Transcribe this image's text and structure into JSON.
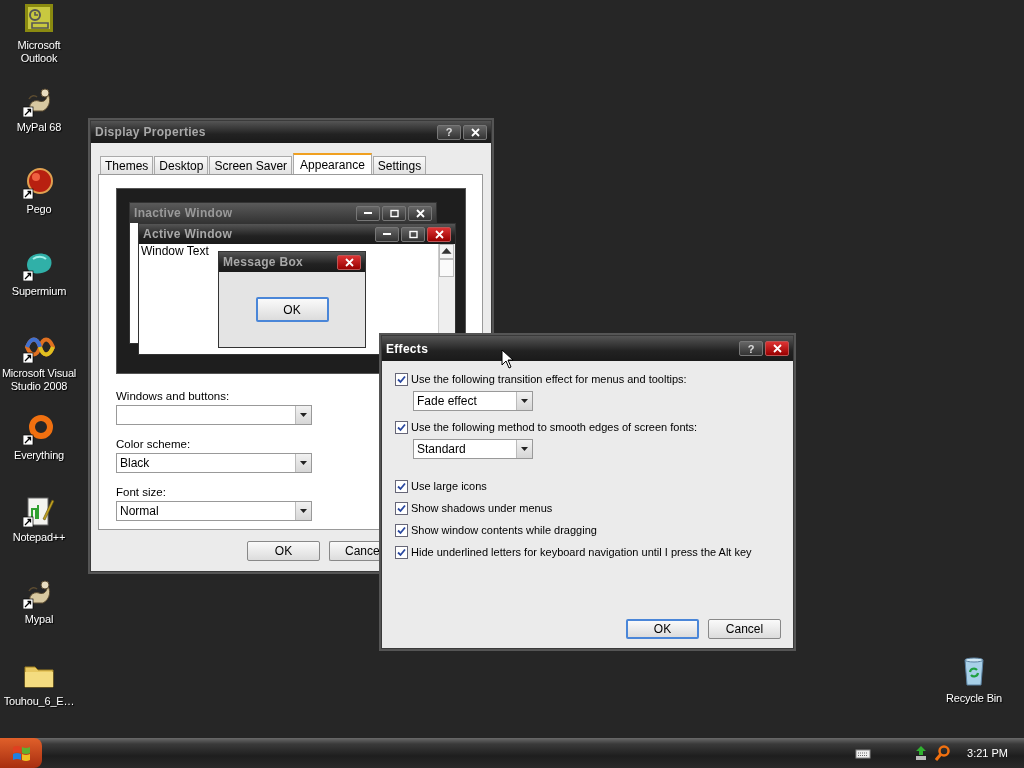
{
  "desktop": {
    "icons": [
      {
        "label": "Microsoft Outlook",
        "kind": "outlook",
        "shortcut": false
      },
      {
        "label": "MyPal 68",
        "kind": "mypal",
        "shortcut": true
      },
      {
        "label": "Pego",
        "kind": "pego",
        "shortcut": true
      },
      {
        "label": "Supermium",
        "kind": "supermium",
        "shortcut": true
      },
      {
        "label": "Microsoft Visual Studio 2008",
        "kind": "visualstudio",
        "shortcut": true
      },
      {
        "label": "Everything",
        "kind": "everything",
        "shortcut": true
      },
      {
        "label": "Notepad++",
        "kind": "notepad",
        "shortcut": true
      },
      {
        "label": "Mypal",
        "kind": "mypal",
        "shortcut": true
      },
      {
        "label": "Touhou_6_E…",
        "kind": "folder",
        "shortcut": false
      }
    ],
    "recycle_bin": {
      "label": "Recycle Bin"
    }
  },
  "display_properties": {
    "title": "Display Properties",
    "help": "?",
    "tabs": [
      {
        "label": "Themes",
        "selected": false
      },
      {
        "label": "Desktop",
        "selected": false
      },
      {
        "label": "Screen Saver",
        "selected": false
      },
      {
        "label": "Appearance",
        "selected": true
      },
      {
        "label": "Settings",
        "selected": false
      }
    ],
    "preview": {
      "inactive_title": "Inactive Window",
      "active_title": "Active Window",
      "window_text": "Window Text",
      "message_title": "Message Box",
      "message_button": {
        "label": "OK",
        "default": true
      }
    },
    "fields": [
      {
        "label": "Windows and buttons:"
      },
      {
        "label": "Color scheme:",
        "value": "Black"
      },
      {
        "label": "Font size:",
        "value": "Normal"
      }
    ],
    "buttons": [
      {
        "label": "OK",
        "default": false
      },
      {
        "label": "Cance",
        "default": false
      }
    ]
  },
  "effects": {
    "title": "Effects",
    "help": "?",
    "options": [
      {
        "label": "Use the following transition effect for menus and tooltips:",
        "checked": true,
        "dropdown": "Fade effect"
      },
      {
        "label": "Use the following method to smooth edges of screen fonts:",
        "checked": true,
        "dropdown": "Standard"
      },
      {
        "label": "Use large icons",
        "checked": true
      },
      {
        "label": "Show shadows under menus",
        "checked": true
      },
      {
        "label": "Show window contents while dragging",
        "checked": true
      },
      {
        "label": "Hide underlined letters for keyboard navigation until I press the Alt key",
        "checked": true
      }
    ],
    "buttons": [
      {
        "label": "OK",
        "default": true
      },
      {
        "label": "Cancel",
        "default": false
      }
    ]
  },
  "taskbar": {
    "clock": "3:21 PM"
  }
}
